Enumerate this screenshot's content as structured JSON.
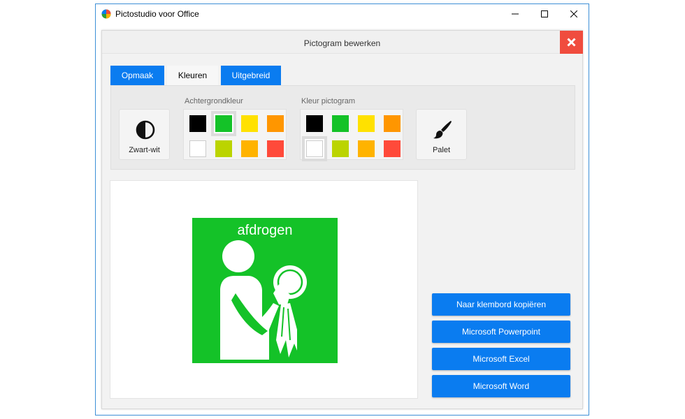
{
  "window": {
    "title": "Pictostudio voor Office"
  },
  "dialog": {
    "title": "Pictogram bewerken"
  },
  "tabs": [
    {
      "label": "Opmaak",
      "active": false
    },
    {
      "label": "Kleuren",
      "active": true
    },
    {
      "label": "Uitgebreid",
      "active": false
    }
  ],
  "toolbar": {
    "zwart_wit_label": "Zwart-wit",
    "palet_label": "Palet",
    "background_group": {
      "label": "Achtergrondkleur",
      "selected": "#14c228",
      "swatches": [
        "#000000",
        "#14c228",
        "#ffe100",
        "#ff9600",
        "#ffffff",
        "#bbd400",
        "#ffb300",
        "#ff4a3a"
      ]
    },
    "picto_group": {
      "label": "Kleur pictogram",
      "selected": "#ffffff",
      "swatches": [
        "#000000",
        "#14c228",
        "#ffe100",
        "#ff9600",
        "#ffffff",
        "#bbd400",
        "#ffb300",
        "#ff4a3a"
      ]
    }
  },
  "preview": {
    "word": "afdrogen",
    "background_color": "#14c228",
    "foreground_color": "#ffffff"
  },
  "actions": [
    {
      "label": "Naar klembord kopiëren"
    },
    {
      "label": "Microsoft Powerpoint"
    },
    {
      "label": "Microsoft Excel"
    },
    {
      "label": "Microsoft Word"
    }
  ],
  "colors": {
    "accent": "#0a7cf0",
    "close": "#f04c3e"
  }
}
